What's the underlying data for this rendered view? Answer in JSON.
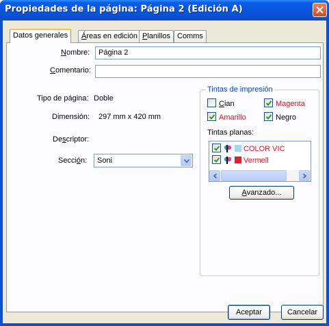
{
  "window": {
    "title": "Propiedades de la página:  Página 2 (Edición A)"
  },
  "tabs": [
    {
      "label": "Datos generales",
      "mnemonic": "",
      "rest": ""
    },
    {
      "mnemonic": "Á",
      "rest": "reas en edición"
    },
    {
      "mnemonic": "P",
      "rest": "lanillos"
    },
    {
      "label": "Comms"
    }
  ],
  "form": {
    "nombre": {
      "pre": "",
      "mn": "N",
      "post": "ombre:",
      "value": "Página 2"
    },
    "comentario": {
      "pre": "",
      "mn": "C",
      "post": "omentario:",
      "value": ""
    },
    "tipo": {
      "label": "Tipo de página:",
      "value": "Doble"
    },
    "dimension": {
      "label": "Dimensión:",
      "value": "297 mm x 420 mm"
    },
    "descriptor": {
      "pre": "De",
      "mn": "s",
      "post": "criptor:"
    },
    "seccion": {
      "pre": "Secci",
      "mn": "ó",
      "post": "n:",
      "value": "Soni"
    }
  },
  "tintas": {
    "title": "Tintas de impresión",
    "cian": {
      "mn": "C",
      "rest": "ian",
      "checked": false
    },
    "magenta": {
      "label": "Magenta",
      "checked": true
    },
    "amarillo": {
      "label": "Amarillo",
      "checked": true
    },
    "negro": {
      "label": "Negro",
      "checked": true
    },
    "planas_label": "Tintas planas:",
    "planas": [
      {
        "name": "COLOR VIC",
        "color": "#9fd8ef",
        "checked": true
      },
      {
        "name": "Vermell",
        "color": "#e01f2a",
        "checked": true
      }
    ],
    "avanzado": {
      "mn": "A",
      "rest": "vanzado..."
    }
  },
  "buttons": {
    "aceptar": "Aceptar",
    "cancelar": "Cancelar"
  },
  "colors": {
    "titlebar": "#0855dd",
    "face": "#ece9d8",
    "tab_accent": "#ffc83c",
    "red_text": "#e01020",
    "group_title": "#0046d5"
  }
}
